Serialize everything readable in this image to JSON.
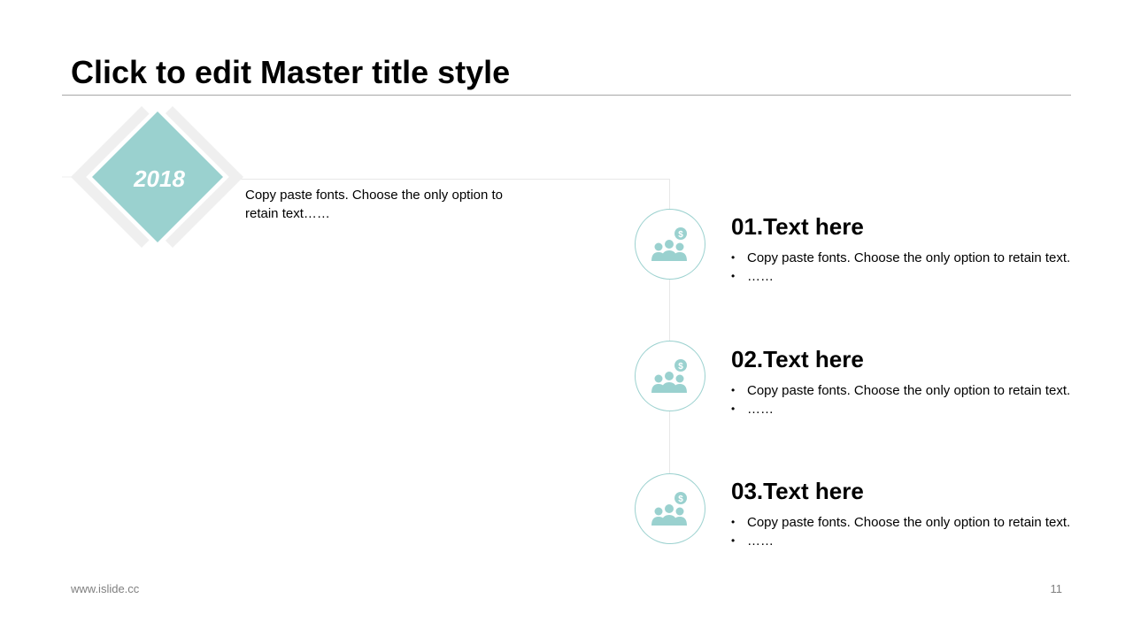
{
  "slide": {
    "title": "Click to edit Master title style",
    "year": "2018",
    "intro": "Copy paste fonts. Choose the only option to retain text……",
    "items": [
      {
        "title": "01.Text here",
        "bullets": [
          "Copy paste fonts. Choose the only option to retain text.",
          "……"
        ],
        "icon": "people-dollar-icon"
      },
      {
        "title": "02.Text here",
        "bullets": [
          "Copy paste fonts. Choose the only option to retain text.",
          "……"
        ],
        "icon": "people-dollar-icon"
      },
      {
        "title": "03.Text here",
        "bullets": [
          "Copy paste fonts. Choose the only option to retain text.",
          "……"
        ],
        "icon": "people-dollar-icon"
      }
    ]
  },
  "footer": {
    "url": "www.islide.cc",
    "page_number": "11"
  },
  "colors": {
    "accent": "#9ad1cf",
    "frame": "#efefef",
    "rule": "#a6a6a6",
    "connector": "#e8e8e8"
  }
}
